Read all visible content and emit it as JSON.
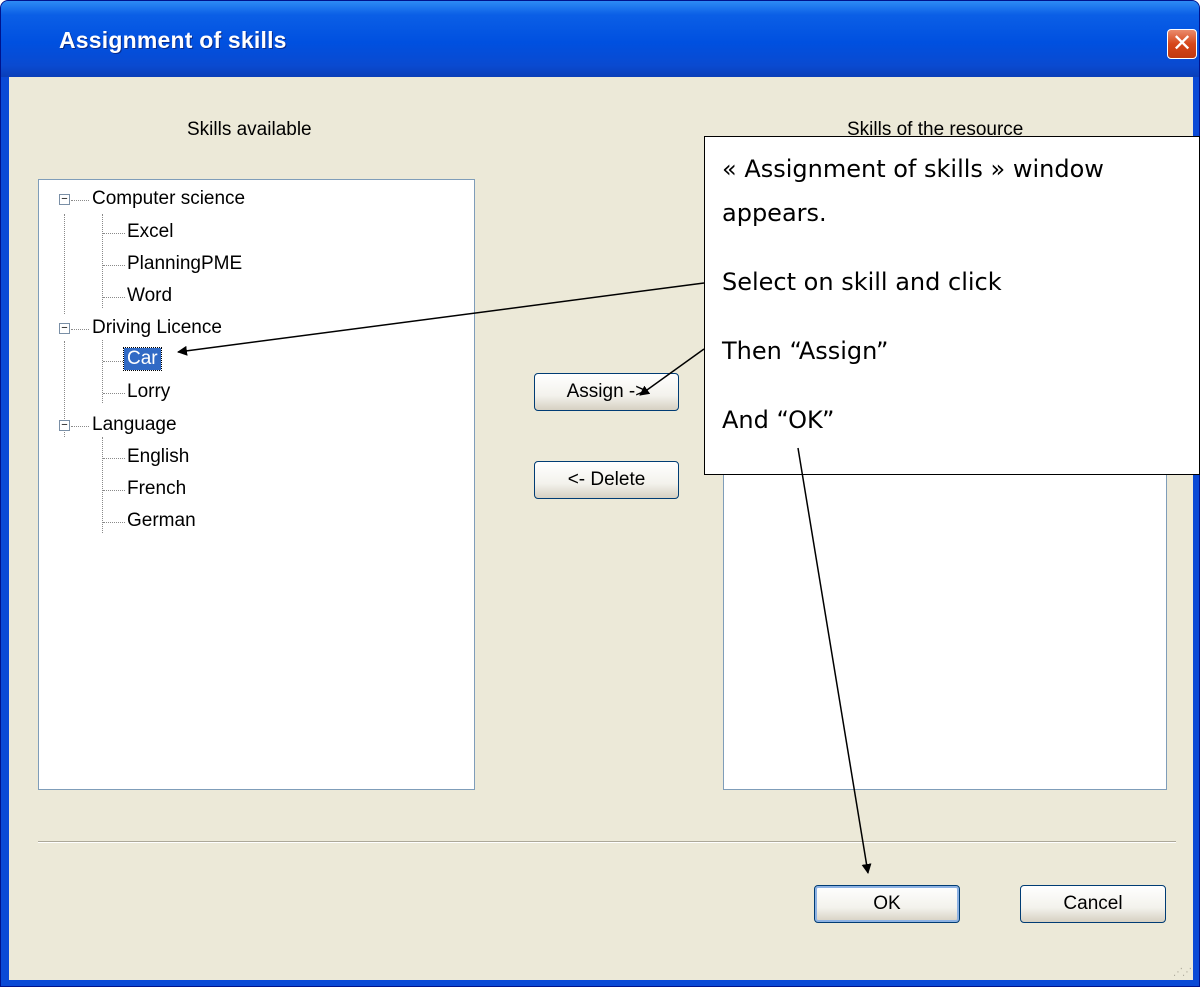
{
  "window": {
    "title": "Assignment of skills",
    "close_symbol": "✕"
  },
  "left_panel": {
    "label": "Skills available",
    "tree": [
      {
        "label": "Computer science",
        "expanded_symbol": "−",
        "children": [
          "Excel",
          "PlanningPME",
          "Word"
        ]
      },
      {
        "label": "Driving Licence",
        "expanded_symbol": "−",
        "children": [
          "Car",
          "Lorry"
        ],
        "selected_child": "Car"
      },
      {
        "label": "Language",
        "expanded_symbol": "−",
        "children": [
          "English",
          "French",
          "German"
        ]
      }
    ]
  },
  "right_panel": {
    "label": "Skills of the resource"
  },
  "buttons": {
    "assign": "Assign ->",
    "delete": "<- Delete",
    "ok": "OK",
    "cancel": "Cancel"
  },
  "callout": {
    "line1": "« Assignment of skills » window",
    "line2": "appears.",
    "line3": "Select on skill and click",
    "line4": "Then “Assign”",
    "line5": "And “OK”"
  },
  "colors": {
    "titlebar": "#0a4ad6",
    "dialog_bg": "#ece9d8",
    "selection": "#316ac5",
    "close_button": "#d6471a"
  }
}
